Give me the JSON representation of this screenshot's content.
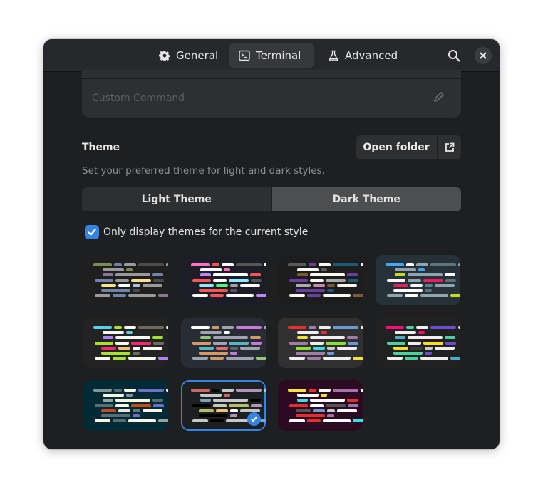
{
  "header": {
    "tabs": [
      {
        "id": "general",
        "label": "General",
        "icon": "gear-icon",
        "active": false
      },
      {
        "id": "terminal",
        "label": "Terminal",
        "icon": "terminal-icon",
        "active": true
      },
      {
        "id": "advanced",
        "label": "Advanced",
        "icon": "flask-icon",
        "active": false
      }
    ],
    "search_icon": "search-icon",
    "close_icon": "close-icon"
  },
  "command": {
    "placeholder": "Custom Command",
    "edit_icon": "pencil-icon"
  },
  "theme": {
    "title": "Theme",
    "subtitle": "Set your preferred theme for light and dark styles.",
    "open_folder_label": "Open folder",
    "open_folder_icon": "external-link-icon",
    "style_tabs": [
      {
        "label": "Light Theme",
        "active": false
      },
      {
        "label": "Dark Theme",
        "active": true
      }
    ],
    "filter_checkbox": {
      "label": "Only display themes for the current style",
      "checked": true
    }
  },
  "colors": {
    "accent": "#3584e4",
    "window_bg": "#1e1f21",
    "header_bg": "#27282b"
  },
  "themes": [
    {
      "bg": "#1f1f1f",
      "selected": false,
      "palette": {
        "a": "#7d8c57",
        "b": "#6f84a8",
        "c": "#9a9a9a",
        "d": "#4b4a4d",
        "e": "#8d7596",
        "f": "#f6e38a",
        "g": "#ffffff",
        "h": "#a9c1e0"
      }
    },
    {
      "bg": "#1d1d28",
      "selected": false,
      "palette": {
        "a": "#ff6fc2",
        "b": "#ff5555",
        "c": "#ffffff",
        "d": "#555555",
        "e": "#bb8cf8",
        "f": "#8be9fd",
        "g": "#50fa7b",
        "h": "#a0a0a0"
      }
    },
    {
      "bg": "#1d1d1d",
      "selected": false,
      "palette": {
        "a": "#5a5a5a",
        "b": "#6b3fa0",
        "c": "#f8f8f0",
        "d": "#1a5a7a",
        "e": "#7d5a35",
        "f": "#aaaaaa",
        "g": "#c48aa6",
        "h": "#7b5a3a"
      }
    },
    {
      "bg": "#263238",
      "selected": false,
      "palette": {
        "a": "#42a5f5",
        "b": "#ffffff",
        "c": "#90a4ae",
        "d": "#5d737e",
        "e": "#c6db1b",
        "f": "#e91e63",
        "g": "#ffffff",
        "h": "#607d8b"
      }
    },
    {
      "bg": "#232323",
      "selected": false,
      "palette": {
        "a": "#58d1eb",
        "b": "#a6e22e",
        "c": "#f8f8f2",
        "d": "#6f6b5a",
        "e": "#ae81ff",
        "f": "#f92672",
        "g": "#f4bf75",
        "h": "#ffffff"
      }
    },
    {
      "bg": "#282c34",
      "selected": false,
      "palette": {
        "a": "#ffffff",
        "b": "#d19a66",
        "c": "#9fa4b0",
        "d": "#c678dd",
        "e": "#98c379",
        "f": "#56b6c2",
        "g": "#e06c75",
        "h": "#5c6370"
      }
    },
    {
      "bg": "#303030",
      "selected": false,
      "palette": {
        "a": "#e52e2e",
        "b": "#a07ca8",
        "c": "#eeeeee",
        "d": "#6a9ad6",
        "e": "#f3e03b",
        "f": "#8ae234",
        "g": "#34e2e2",
        "h": "#cccccc"
      }
    },
    {
      "bg": "#212121",
      "selected": false,
      "palette": {
        "a": "#ff0a78",
        "b": "#4bd0a0",
        "c": "#eeeeee",
        "d": "#6a4fd6",
        "e": "#48b0c8",
        "f": "#ffdd22",
        "g": "#3a3a3a",
        "h": "#cccccc"
      }
    },
    {
      "bg": "#002b36",
      "selected": false,
      "palette": {
        "a": "#839496",
        "b": "#586e75",
        "c": "#fdf6e3",
        "d": "#6c71c4",
        "e": "#93a1a1",
        "f": "#cb4b16",
        "g": "#eee8d5",
        "h": "#657b83"
      }
    },
    {
      "bg": "#1e1f21",
      "selected": true,
      "palette": {
        "a": "#cc6666",
        "b": "#000000",
        "c": "#c5c8c6",
        "d": "#b294bb",
        "e": "#81a2be",
        "f": "#b5bd68",
        "g": "#f0c674",
        "h": "#ffffff"
      }
    },
    {
      "bg": "#2c0a22",
      "selected": false,
      "palette": {
        "a": "#f6e23a",
        "b": "#e52e2e",
        "c": "#ffffff",
        "d": "#a074a8",
        "e": "#34e2e2",
        "f": "#555555",
        "g": "#6e9bd4",
        "h": "#cccccc"
      }
    }
  ]
}
